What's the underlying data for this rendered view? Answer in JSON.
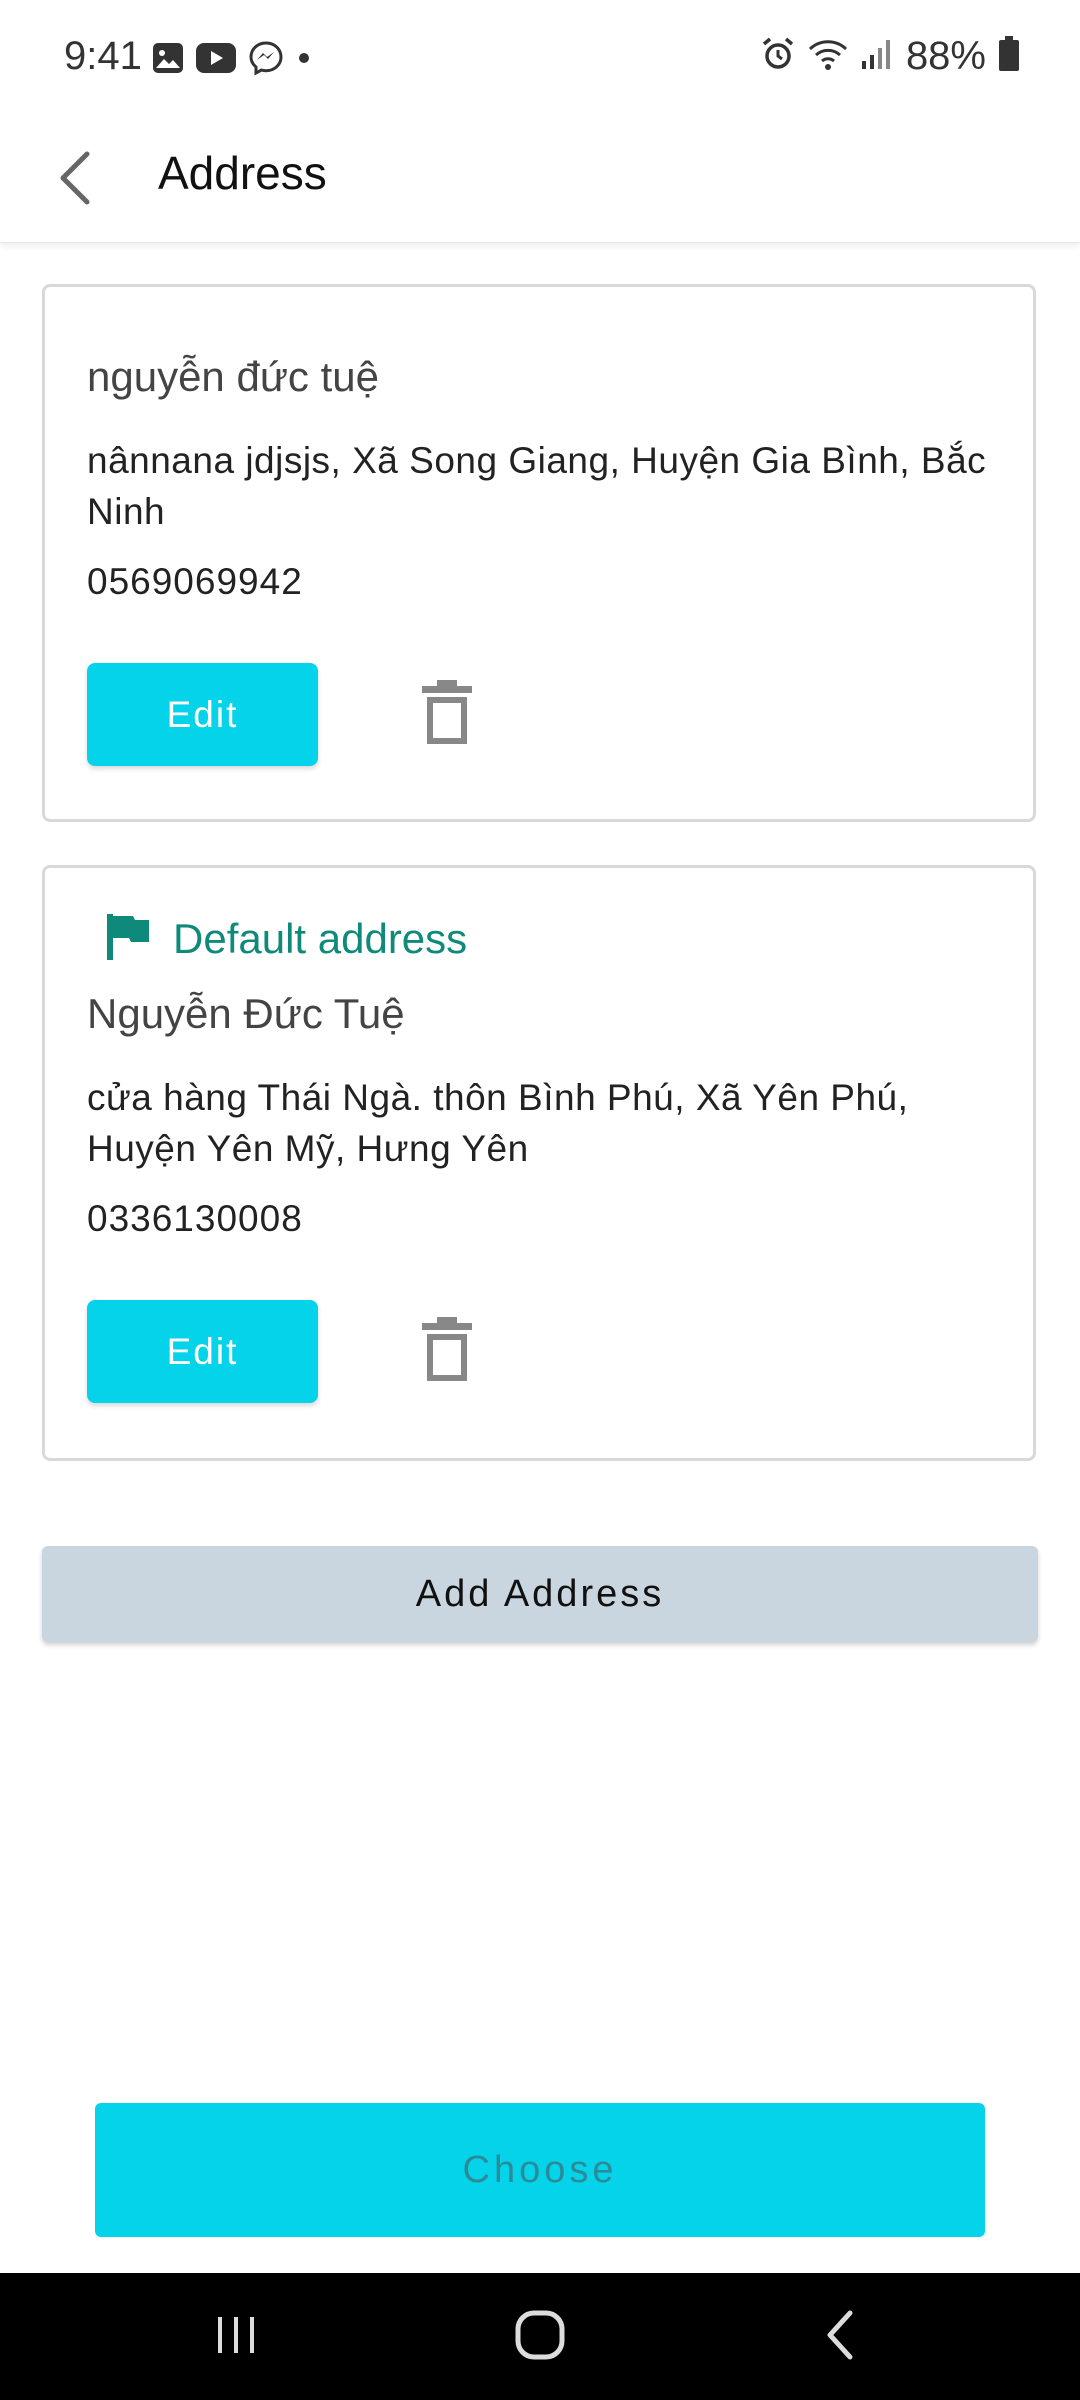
{
  "status_bar": {
    "time": "9:41",
    "battery": "88%",
    "left_icons": [
      "gallery-icon",
      "youtube-icon",
      "messenger-icon",
      "dot-icon"
    ],
    "right_icons": [
      "alarm-icon",
      "wifi-icon",
      "signal-icon",
      "battery-icon"
    ]
  },
  "app_bar": {
    "back_icon": "chevron-left-icon",
    "title": "Address"
  },
  "addresses": [
    {
      "is_default": false,
      "name": "nguyễn đức tuệ",
      "address": "nânnana jdjsjs, Xã Song Giang, Huyện Gia Bình, Bắc Ninh",
      "phone": "0569069942",
      "edit_label": "Edit",
      "delete_icon": "trash-icon"
    },
    {
      "is_default": true,
      "default_label": "Default address",
      "default_icon": "flag-icon",
      "name": "Nguyễn Đức Tuệ",
      "address": "cửa hàng Thái Ngà. thôn Bình Phú, Xã Yên Phú, Huyện Yên Mỹ, Hưng Yên",
      "phone": "0336130008",
      "edit_label": "Edit",
      "delete_icon": "trash-icon"
    }
  ],
  "add_address_label": "Add Address",
  "choose_label": "Choose",
  "nav_bar": {
    "buttons": [
      "recents-icon",
      "home-icon",
      "back-icon"
    ]
  },
  "colors": {
    "accent": "#05d3ea",
    "default_flag": "#0f8a7a",
    "add_button_bg": "#c9d6df",
    "choose_text": "#2b8c99",
    "nav_bar_bg": "#000000"
  }
}
